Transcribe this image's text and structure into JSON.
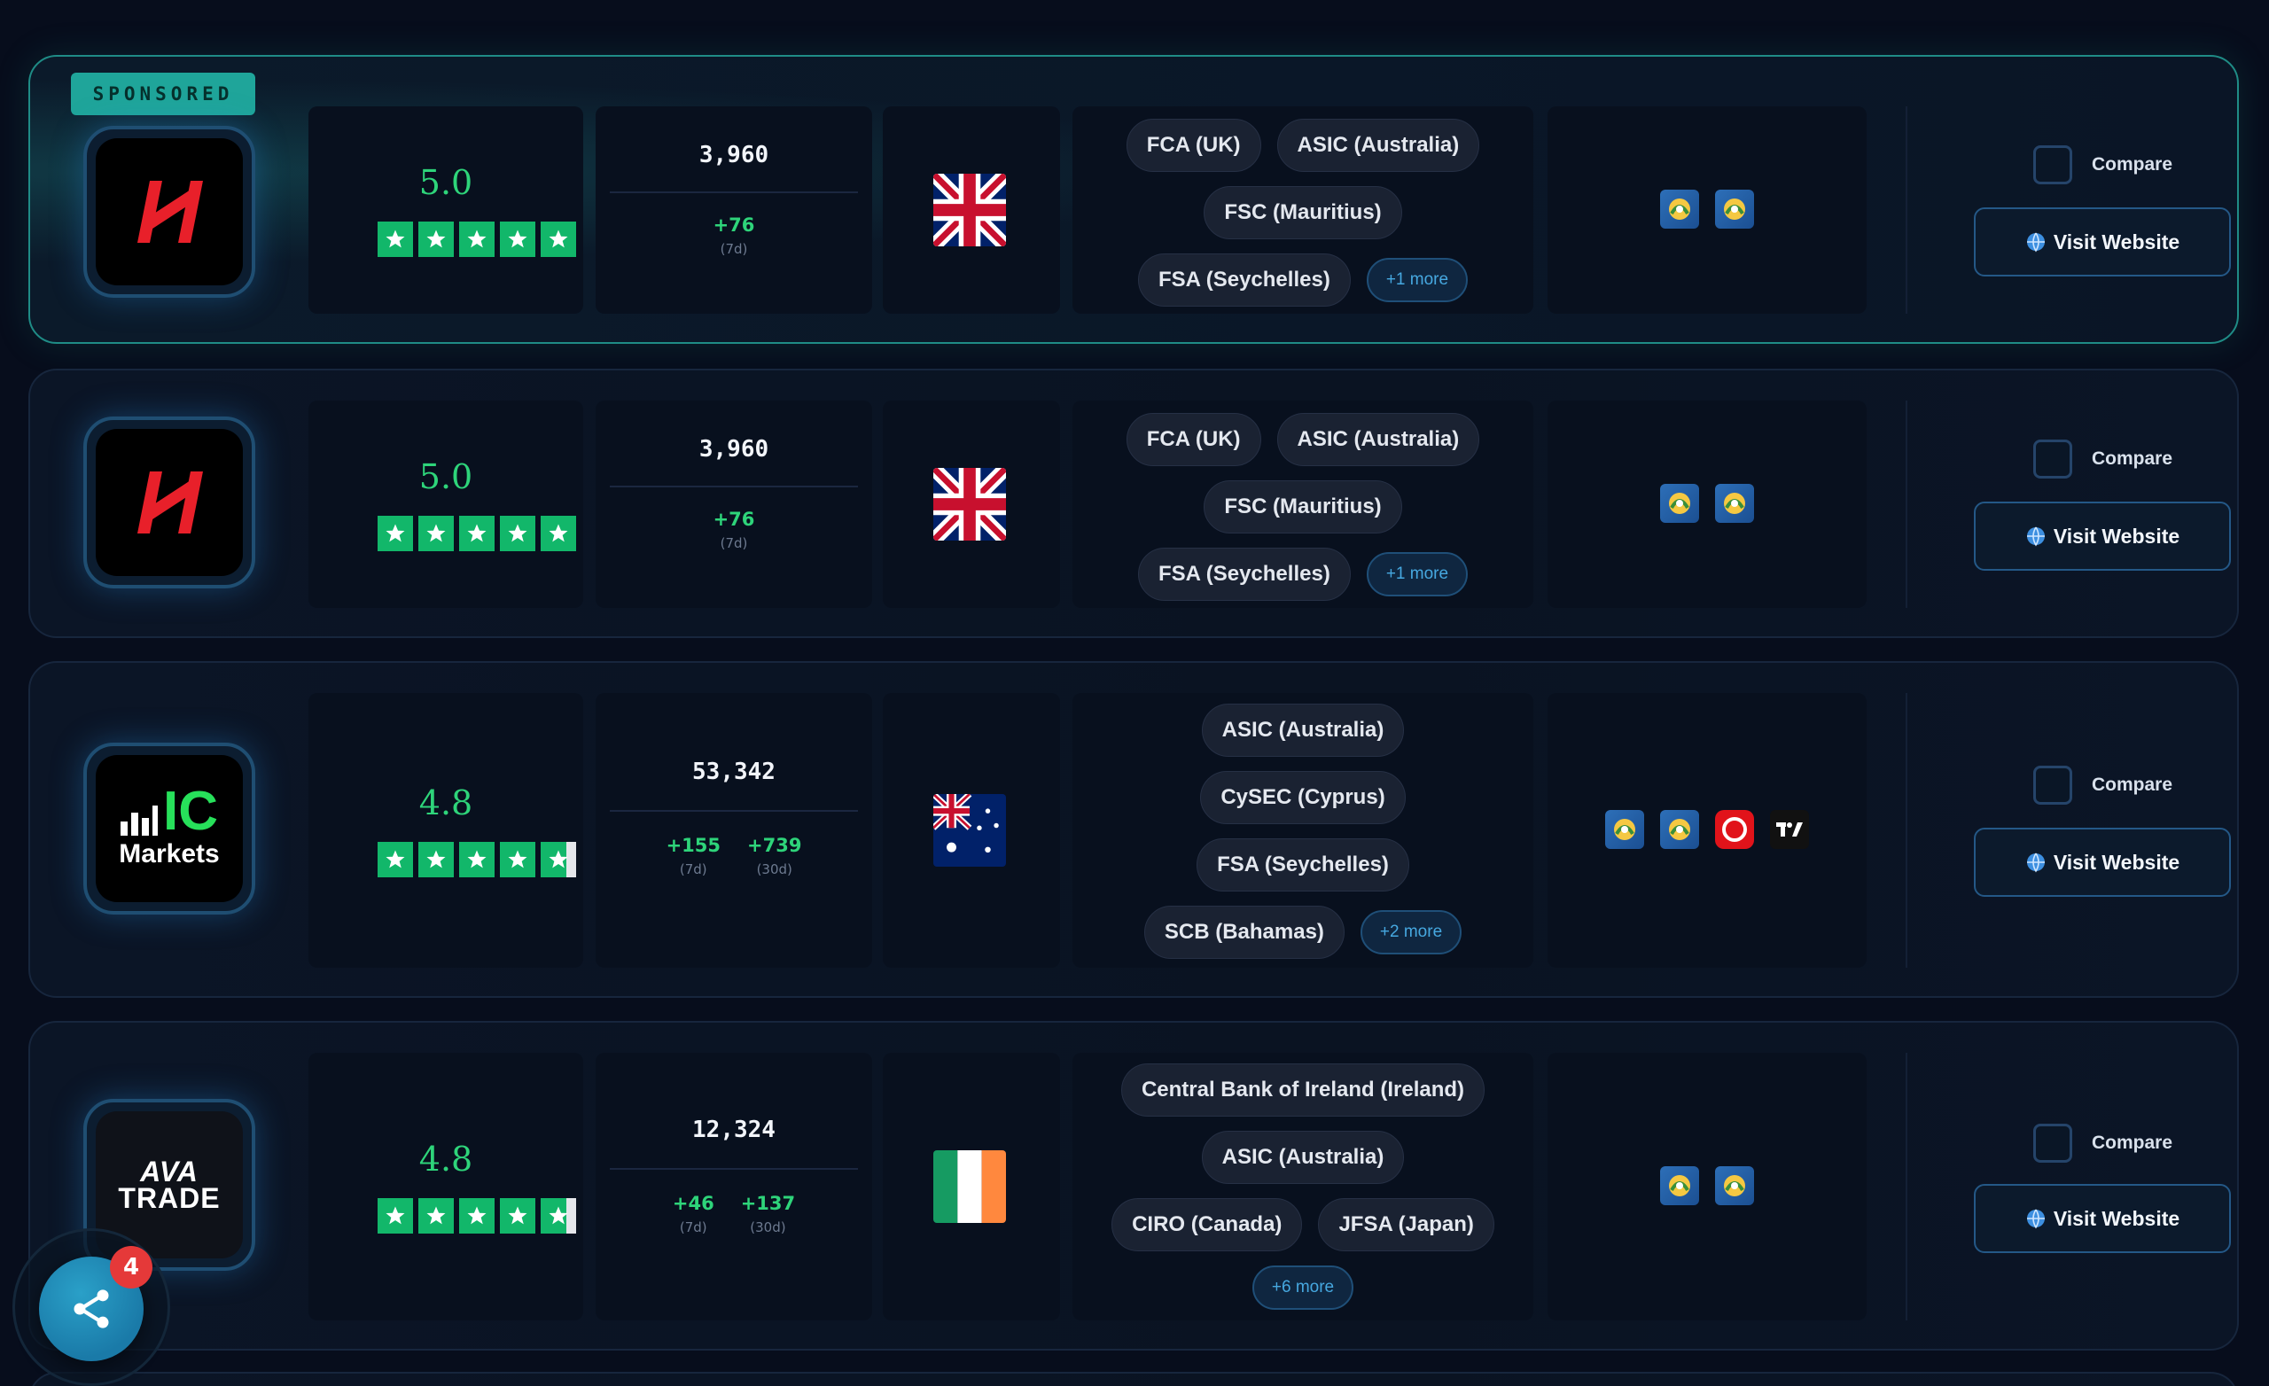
{
  "brokers": [
    {
      "sponsored": true,
      "sponsored_label": "SPONSORED",
      "logo": "mexem-icon",
      "score": "5.0",
      "stars": 5,
      "clients_total": "3,960",
      "deltas": [
        {
          "value": "+76",
          "label": "(7d)"
        }
      ],
      "flag": "uk-flag",
      "regulators": [
        "FCA (UK)",
        "ASIC (Australia)",
        "FSC (Mauritius)",
        "FSA (Seychelles)"
      ],
      "more": "+1 more",
      "platforms": [
        "mt4-icon",
        "mt5-icon"
      ],
      "compare": "Compare",
      "visit": "Visit Website"
    },
    {
      "sponsored": false,
      "logo": "mexem-icon",
      "score": "5.0",
      "stars": 5,
      "clients_total": "3,960",
      "deltas": [
        {
          "value": "+76",
          "label": "(7d)"
        }
      ],
      "flag": "uk-flag",
      "regulators": [
        "FCA (UK)",
        "ASIC (Australia)",
        "FSC (Mauritius)",
        "FSA (Seychelles)"
      ],
      "more": "+1 more",
      "platforms": [
        "mt4-icon",
        "mt5-icon"
      ],
      "compare": "Compare",
      "visit": "Visit Website"
    },
    {
      "sponsored": false,
      "logo": "ic-markets-logo",
      "logo_text": [
        "IC",
        "Markets"
      ],
      "score": "4.8",
      "stars": 4.8,
      "clients_total": "53,342",
      "deltas": [
        {
          "value": "+155",
          "label": "(7d)"
        },
        {
          "value": "+739",
          "label": "(30d)"
        }
      ],
      "flag": "australia-flag",
      "regulators": [
        "ASIC (Australia)",
        "CySEC (Cyprus)",
        "FSA (Seychelles)",
        "SCB (Bahamas)"
      ],
      "more": "+2 more",
      "platforms": [
        "mt4-icon",
        "mt5-icon",
        "ctrader-icon",
        "tradingview-icon"
      ],
      "compare": "Compare",
      "visit": "Visit Website"
    },
    {
      "sponsored": false,
      "logo": "avatrade-logo",
      "logo_text": [
        "AVA",
        "TRADE"
      ],
      "score": "4.8",
      "stars": 4.8,
      "clients_total": "12,324",
      "deltas": [
        {
          "value": "+46",
          "label": "(7d)"
        },
        {
          "value": "+137",
          "label": "(30d)"
        }
      ],
      "flag": "ireland-flag",
      "regulators": [
        "Central Bank of Ireland (Ireland)",
        "ASIC (Australia)",
        "CIRO (Canada)",
        "JFSA (Japan)"
      ],
      "more": "+6 more",
      "platforms": [
        "mt4-icon",
        "mt5-icon"
      ],
      "compare": "Compare",
      "visit": "Visit Website"
    }
  ],
  "share": {
    "badge": "4",
    "icon": "share-icon"
  },
  "colors": {
    "accent": "#2ed47a",
    "sponsored_border": "#1f8c86",
    "star": "#12b76a",
    "badge": "#e53939"
  }
}
